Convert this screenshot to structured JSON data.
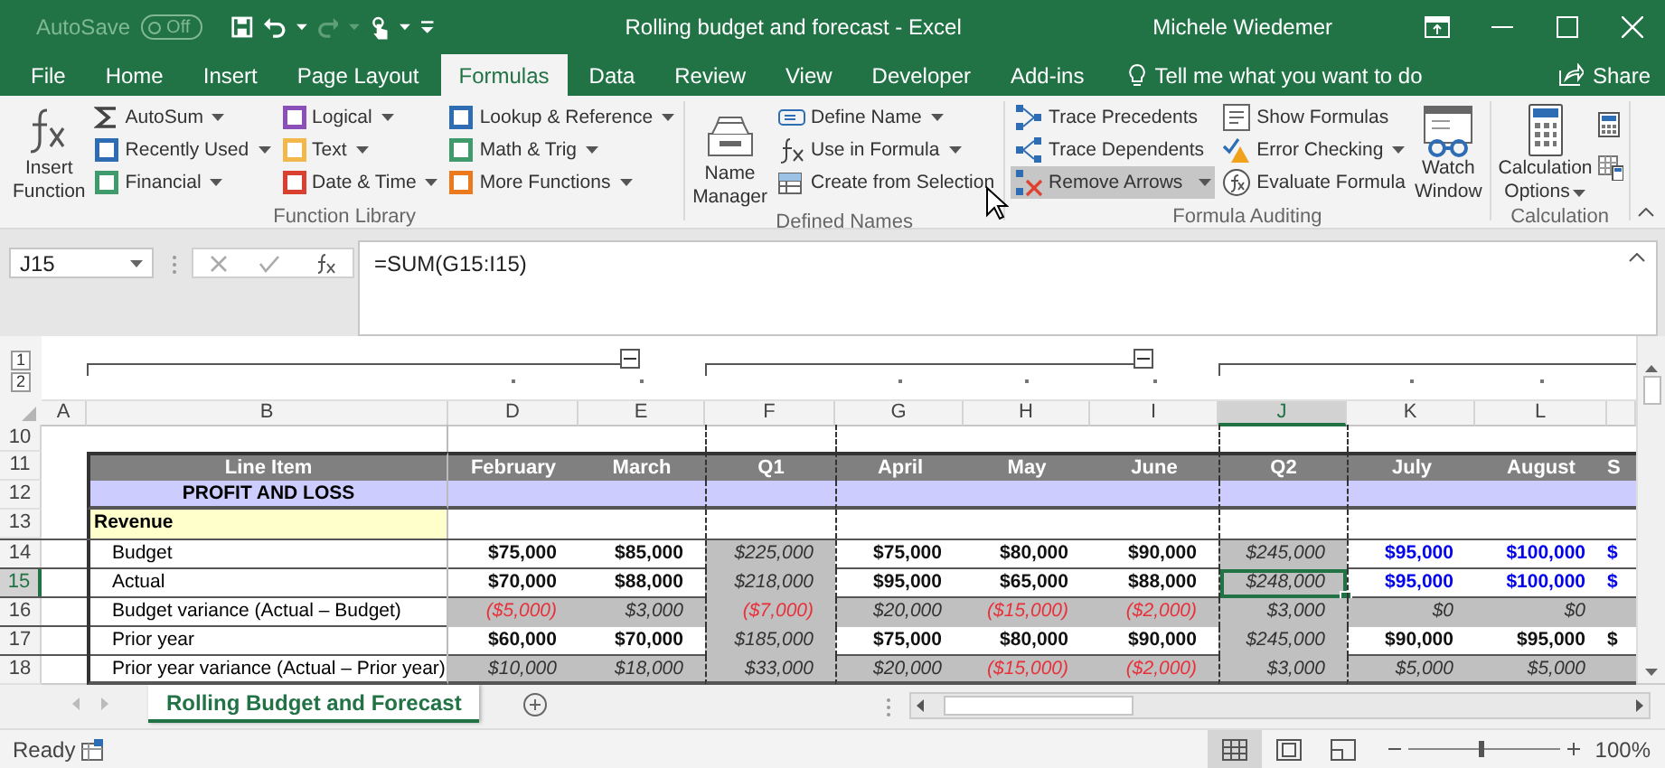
{
  "title_bar": {
    "autosave_label": "AutoSave",
    "autosave": {
      "label": "Off",
      "on": false
    },
    "title": "Rolling budget and forecast  -  Excel",
    "user": "Michele Wiedemer"
  },
  "tabs": [
    {
      "label": "File",
      "selected": false
    },
    {
      "label": "Home",
      "selected": false
    },
    {
      "label": "Insert",
      "selected": false
    },
    {
      "label": "Page Layout",
      "selected": false
    },
    {
      "label": "Formulas",
      "selected": true
    },
    {
      "label": "Data",
      "selected": false
    },
    {
      "label": "Review",
      "selected": false
    },
    {
      "label": "View",
      "selected": false
    },
    {
      "label": "Developer",
      "selected": false
    },
    {
      "label": "Add-ins",
      "selected": false
    }
  ],
  "tell_me": {
    "placeholder": "Tell me what you want to do"
  },
  "share": "Share",
  "ribbon": {
    "groups": [
      {
        "name": "Function Library",
        "parts": [
          {
            "kind": "large",
            "label": "Insert Function",
            "dropdown": false
          },
          {
            "kind": "column",
            "items": [
              {
                "label": "AutoSum",
                "dropdown": true,
                "hovered": false
              },
              {
                "label": "Recently Used",
                "dropdown": true,
                "hovered": false,
                "color": "#2e6db4"
              },
              {
                "label": "Financial",
                "dropdown": true,
                "hovered": false,
                "color": "#3f9b6b"
              }
            ]
          },
          {
            "kind": "column",
            "items": [
              {
                "label": "Logical",
                "dropdown": true,
                "hovered": false,
                "color": "#8a4fb8"
              },
              {
                "label": "Text",
                "dropdown": true,
                "hovered": false,
                "color": "#f2b84b"
              },
              {
                "label": "Date & Time",
                "dropdown": true,
                "hovered": false,
                "color": "#d9402f"
              }
            ]
          },
          {
            "kind": "column",
            "items": [
              {
                "label": "Lookup & Reference",
                "dropdown": true,
                "hovered": false,
                "color": "#2e6db4"
              },
              {
                "label": "Math & Trig",
                "dropdown": true,
                "hovered": false,
                "color": "#3f9b6b"
              },
              {
                "label": "More Functions",
                "dropdown": true,
                "hovered": false,
                "color": "#ec7a1c"
              }
            ]
          }
        ]
      },
      {
        "name": "Defined Names",
        "parts": [
          {
            "kind": "large",
            "label": "Name Manager",
            "dropdown": false
          },
          {
            "kind": "column",
            "items": [
              {
                "label": "Define Name",
                "dropdown": true,
                "hovered": false
              },
              {
                "label": "Use in Formula",
                "dropdown": true,
                "hovered": false
              },
              {
                "label": "Create from Selection",
                "dropdown": false,
                "hovered": false
              }
            ]
          }
        ]
      },
      {
        "name": "Formula Auditing",
        "parts": [
          {
            "kind": "column",
            "items": [
              {
                "label": "Trace Precedents",
                "dropdown": false,
                "hovered": false
              },
              {
                "label": "Trace Dependents",
                "dropdown": false,
                "hovered": false
              },
              {
                "label": "Remove Arrows",
                "dropdown": true,
                "hovered": true
              }
            ]
          },
          {
            "kind": "column",
            "items": [
              {
                "label": "Show Formulas",
                "dropdown": false,
                "hovered": false
              },
              {
                "label": "Error Checking",
                "dropdown": true,
                "hovered": false
              },
              {
                "label": "Evaluate Formula",
                "dropdown": false,
                "hovered": false
              }
            ]
          },
          {
            "kind": "large",
            "label": "Watch Window",
            "dropdown": false
          }
        ]
      },
      {
        "name": "Calculation",
        "parts": [
          {
            "kind": "large",
            "label": "Calculation Options",
            "dropdown": true
          },
          {
            "kind": "icon_column"
          }
        ]
      }
    ]
  },
  "formula_bar": {
    "name_box": "J15",
    "formula": "=SUM(G15:I15)"
  },
  "sheet": {
    "outline_levels": [
      "1",
      "2"
    ],
    "outline_groups": [
      {
        "expanded": true
      },
      {
        "expanded": true
      }
    ],
    "columns": [
      {
        "label": "A",
        "selected": false
      },
      {
        "label": "B",
        "selected": false
      },
      {
        "label": "D",
        "selected": false
      },
      {
        "label": "E",
        "selected": false
      },
      {
        "label": "F",
        "selected": false
      },
      {
        "label": "G",
        "selected": false
      },
      {
        "label": "H",
        "selected": false
      },
      {
        "label": "I",
        "selected": false
      },
      {
        "label": "J",
        "selected": true
      },
      {
        "label": "K",
        "selected": false
      },
      {
        "label": "L",
        "selected": false
      }
    ],
    "rows": [
      {
        "number": "10",
        "selected": false,
        "kind": "blank"
      },
      {
        "number": "11",
        "selected": false,
        "kind": "header",
        "label": "Line Item",
        "cells": [
          "February",
          "March",
          "Q1",
          "April",
          "May",
          "June",
          "Q2",
          "July",
          "August",
          "S"
        ]
      },
      {
        "number": "12",
        "selected": false,
        "kind": "band",
        "label": "PROFIT AND LOSS"
      },
      {
        "number": "13",
        "selected": false,
        "kind": "section",
        "label": "Revenue"
      },
      {
        "number": "14",
        "selected": false,
        "kind": "line",
        "label": "Budget",
        "shaded": false,
        "cells": [
          {
            "text": "$75,000",
            "kind": "bold"
          },
          {
            "text": "$85,000",
            "kind": "bold"
          },
          {
            "text": "$225,000",
            "kind": "italic"
          },
          {
            "text": "$75,000",
            "kind": "bold"
          },
          {
            "text": "$80,000",
            "kind": "bold"
          },
          {
            "text": "$90,000",
            "kind": "bold"
          },
          {
            "text": "$245,000",
            "kind": "italic"
          },
          {
            "text": "$95,000",
            "kind": "blue"
          },
          {
            "text": "$100,000",
            "kind": "blue"
          },
          {
            "text": "$",
            "kind": "blue"
          }
        ]
      },
      {
        "number": "15",
        "selected": true,
        "kind": "line",
        "label": "Actual",
        "shaded": false,
        "cells": [
          {
            "text": "$70,000",
            "kind": "bold"
          },
          {
            "text": "$88,000",
            "kind": "bold"
          },
          {
            "text": "$218,000",
            "kind": "italic"
          },
          {
            "text": "$95,000",
            "kind": "bold"
          },
          {
            "text": "$65,000",
            "kind": "bold"
          },
          {
            "text": "$88,000",
            "kind": "bold"
          },
          {
            "text": "$248,000",
            "kind": "italic"
          },
          {
            "text": "$95,000",
            "kind": "blue"
          },
          {
            "text": "$100,000",
            "kind": "blue"
          },
          {
            "text": "$",
            "kind": "blue"
          }
        ]
      },
      {
        "number": "16",
        "selected": false,
        "kind": "line",
        "label": "Budget variance (Actual – Budget)",
        "shaded": true,
        "cells": [
          {
            "text": "($5,000)",
            "kind": "red"
          },
          {
            "text": "$3,000",
            "kind": "italic"
          },
          {
            "text": "($7,000)",
            "kind": "red"
          },
          {
            "text": "$20,000",
            "kind": "italic"
          },
          {
            "text": "($15,000)",
            "kind": "red"
          },
          {
            "text": "($2,000)",
            "kind": "red"
          },
          {
            "text": "$3,000",
            "kind": "italic"
          },
          {
            "text": "$0",
            "kind": "italic"
          },
          {
            "text": "$0",
            "kind": "italic"
          }
        ]
      },
      {
        "number": "17",
        "selected": false,
        "kind": "line",
        "label": "Prior year",
        "shaded": false,
        "cells": [
          {
            "text": "$60,000",
            "kind": "bold"
          },
          {
            "text": "$70,000",
            "kind": "bold"
          },
          {
            "text": "$185,000",
            "kind": "italic"
          },
          {
            "text": "$75,000",
            "kind": "bold"
          },
          {
            "text": "$80,000",
            "kind": "bold"
          },
          {
            "text": "$90,000",
            "kind": "bold"
          },
          {
            "text": "$245,000",
            "kind": "italic"
          },
          {
            "text": "$90,000",
            "kind": "bold"
          },
          {
            "text": "$95,000",
            "kind": "bold"
          },
          {
            "text": "$",
            "kind": "bold"
          }
        ]
      },
      {
        "number": "18",
        "selected": false,
        "kind": "line",
        "label": "Prior year variance (Actual – Prior year)",
        "shaded": true,
        "cells": [
          {
            "text": "$10,000",
            "kind": "italic"
          },
          {
            "text": "$18,000",
            "kind": "italic"
          },
          {
            "text": "$33,000",
            "kind": "italic"
          },
          {
            "text": "$20,000",
            "kind": "italic"
          },
          {
            "text": "($15,000)",
            "kind": "red"
          },
          {
            "text": "($2,000)",
            "kind": "red"
          },
          {
            "text": "$3,000",
            "kind": "italic"
          },
          {
            "text": "$5,000",
            "kind": "italic"
          },
          {
            "text": "$5,000",
            "kind": "italic"
          }
        ]
      }
    ]
  },
  "sheet_tabs": [
    {
      "label": "Rolling Budget and Forecast",
      "selected": true
    }
  ],
  "status_bar": {
    "status": "Ready",
    "views": [
      {
        "selected": true
      },
      {
        "selected": false
      },
      {
        "selected": false
      }
    ],
    "zoom": {
      "level": 0.47,
      "reading": "100%"
    }
  }
}
